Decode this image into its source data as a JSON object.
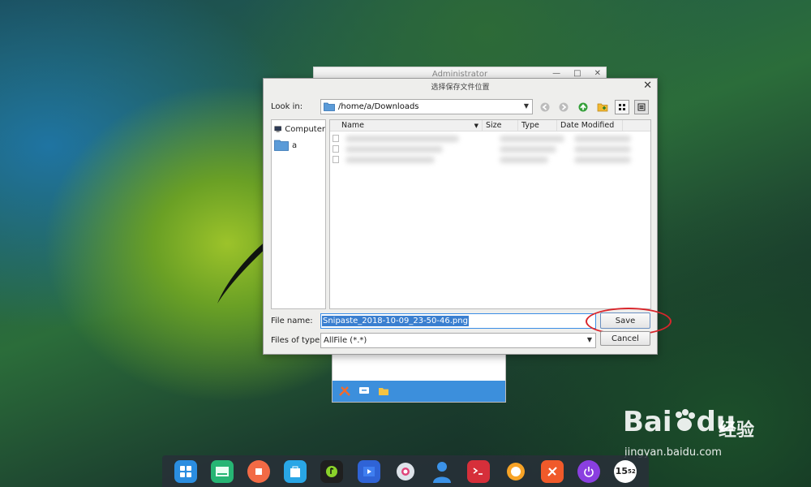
{
  "background_window": {
    "title": "Administrator"
  },
  "dialog": {
    "title": "选择保存文件位置",
    "look_in_label": "Look in:",
    "look_in_path": "/home/a/Downloads",
    "sidebar": [
      {
        "label": "Computer",
        "icon": "computer-icon"
      },
      {
        "label": "a",
        "icon": "folder-icon"
      }
    ],
    "columns": [
      "Name",
      "Size",
      "Type",
      "Date Modified"
    ],
    "file_name_label": "File name:",
    "file_name_value": "Snipaste_2018-10-09_23-50-46.png",
    "files_of_type_label": "Files of type:",
    "files_of_type_value": "AllFile (*.*)",
    "save_label": "Save",
    "cancel_label": "Cancel"
  },
  "watermark": {
    "brand_latin": "Bai",
    "brand_latin2": "du",
    "brand_cn": "经验",
    "url": "jingyan.baidu.com"
  },
  "dock": {
    "clock_hour": "15",
    "clock_min": "52"
  },
  "colors": {
    "accent": "#3a7fd0",
    "highlight_ring": "#d9262c"
  }
}
